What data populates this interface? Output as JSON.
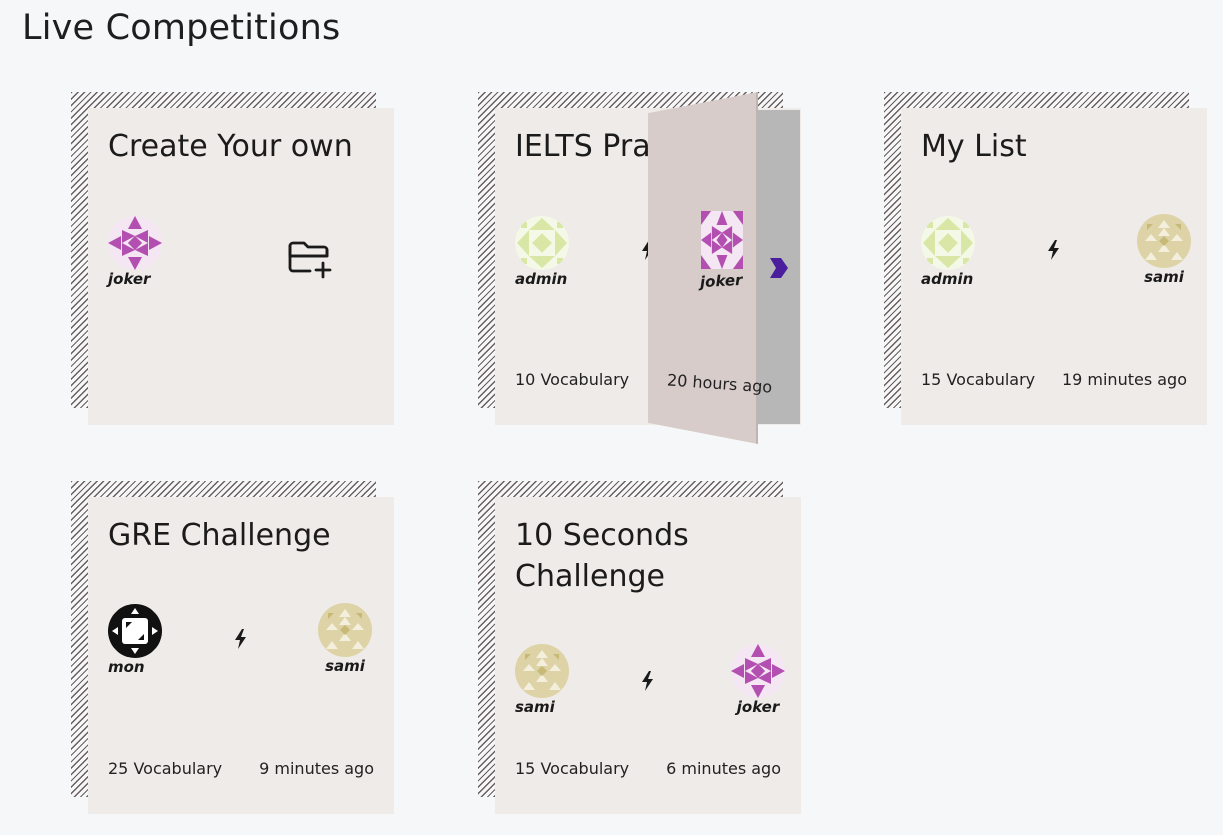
{
  "page": {
    "title": "Live Competitions"
  },
  "cards": [
    {
      "title": "Create Your own",
      "player": "joker"
    },
    {
      "title": "IELTS Practice",
      "player1": "admin",
      "player2": "joker",
      "vocab": "10 Vocabulary",
      "time": "20 hours ago"
    },
    {
      "title": "My List",
      "player1": "admin",
      "player2": "sami",
      "vocab": "15 Vocabulary",
      "time": "19 minutes ago"
    },
    {
      "title": "GRE Challenge",
      "player1": "mon",
      "player2": "sami",
      "vocab": "25 Vocabulary",
      "time": "9 minutes ago"
    },
    {
      "title": "10 Seconds Challenge",
      "player1": "sami",
      "player2": "joker",
      "vocab": "15 Vocabulary",
      "time": "6 minutes ago"
    }
  ],
  "icons": {
    "versus": "lightning-bolt-icon",
    "create": "folder-plus-icon",
    "next": "chevron-right-icon"
  },
  "colors": {
    "card_bg": "#efebe8",
    "page_bg": "#f6f7f9",
    "accent_purple": "#4b1e9e",
    "avatar_magenta": "#b34fb0",
    "avatar_lime": "#e3efbf",
    "avatar_tan": "#cfc38c"
  }
}
